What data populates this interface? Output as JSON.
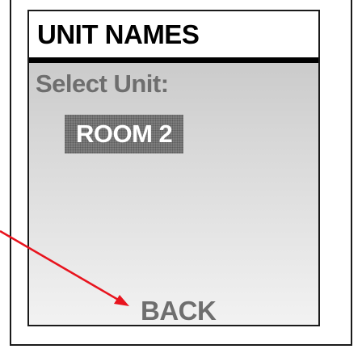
{
  "screen": {
    "title": "UNIT NAMES",
    "select_label": "Select Unit:",
    "units": [
      {
        "label": "ROOM 2",
        "selected": true
      }
    ],
    "back_label": "BACK"
  },
  "annotation": {
    "arrow_color": "#e8141e",
    "icon": "pointer-arrow"
  }
}
